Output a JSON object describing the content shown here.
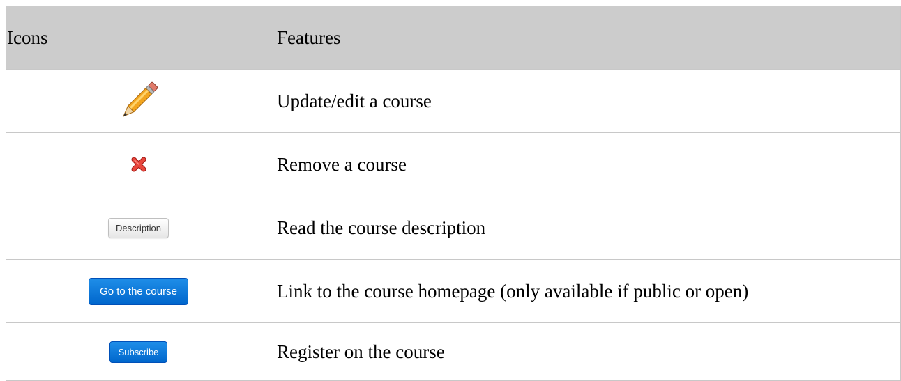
{
  "table": {
    "headers": {
      "icons": "Icons",
      "features": "Features"
    },
    "rows": [
      {
        "icon": "pencil-icon",
        "feature": "Update/edit a course"
      },
      {
        "icon": "close-icon",
        "feature": "Remove a course"
      },
      {
        "icon": "button",
        "button_label": "Description",
        "feature": "Read the course description"
      },
      {
        "icon": "button",
        "button_label": "Go to the course",
        "feature": "Link to the course homepage (only available if public or open)"
      },
      {
        "icon": "button",
        "button_label": "Subscribe",
        "feature": "Register on the course"
      }
    ]
  },
  "colors": {
    "header_bg": "#cccccc",
    "border": "#c8c8c8",
    "primary_button": "#0066cc",
    "remove_icon": "#d9302a",
    "pencil_body": "#f2a51f"
  }
}
